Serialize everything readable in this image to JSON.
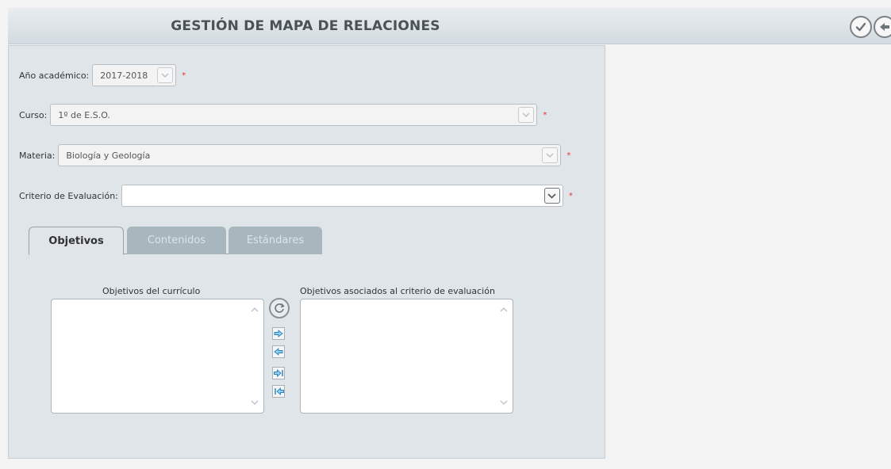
{
  "header": {
    "title": "GESTIÓN DE MAPA DE RELACIONES",
    "accept_icon": "check-circle-icon",
    "back_icon": "back-arrow-circle-icon"
  },
  "form": {
    "year": {
      "label": "Año académico:",
      "value": "2017-2018"
    },
    "course": {
      "label": "Curso:",
      "value": "1º de E.S.O."
    },
    "subject": {
      "label": "Materia:",
      "value": "Biología y Geología"
    },
    "criterion": {
      "label": "Criterio de Evaluación:",
      "value": ""
    },
    "required_mark": "*"
  },
  "tabs": [
    {
      "label": "Objetivos",
      "active": true
    },
    {
      "label": "Contenidos",
      "active": false
    },
    {
      "label": "Estándares",
      "active": false
    }
  ],
  "lists": {
    "left_label": "Objetivos del currículo",
    "right_label": "Objetivos asociados al criterio de evaluación"
  },
  "colors": {
    "required": "#e33333",
    "panel_bg": "#dfe5e9",
    "inactive_tab": "#a8b6bd"
  }
}
